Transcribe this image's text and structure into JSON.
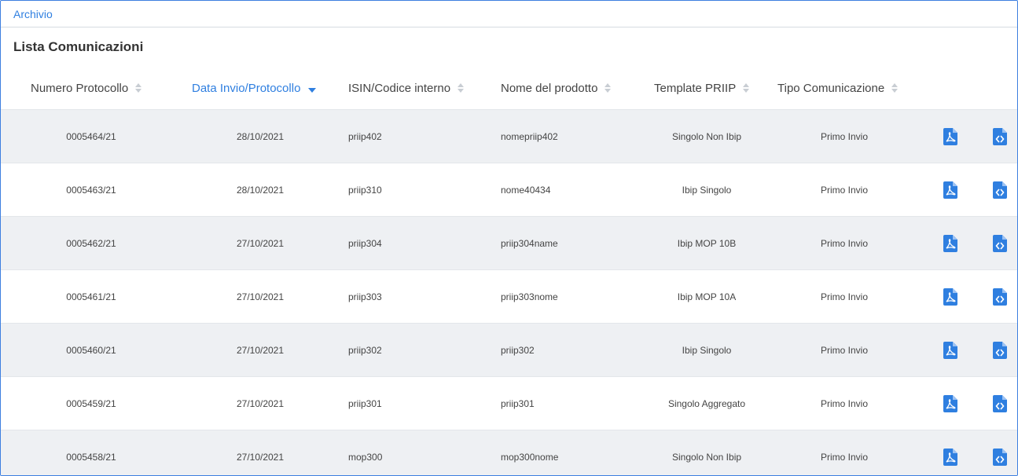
{
  "breadcrumb": {
    "label": "Archivio"
  },
  "page": {
    "title": "Lista Comunicazioni"
  },
  "colors": {
    "accent": "#2f7fe0",
    "row_alt": "#eef0f3"
  },
  "table": {
    "columns": [
      {
        "label": "Numero Protocollo",
        "sort": "none"
      },
      {
        "label": "Data Invio/Protocollo",
        "sort": "desc"
      },
      {
        "label": "ISIN/Codice interno",
        "sort": "none"
      },
      {
        "label": "Nome del prodotto",
        "sort": "none"
      },
      {
        "label": "Template PRIIP",
        "sort": "none"
      },
      {
        "label": "Tipo Comunicazione",
        "sort": "none"
      }
    ],
    "row_icons": [
      "pdf-file-icon",
      "code-file-icon"
    ],
    "rows": [
      {
        "protocol": "0005464/21",
        "date": "28/10/2021",
        "isin": "priip402",
        "name": "nomepriip402",
        "template": "Singolo Non Ibip",
        "type": "Primo Invio"
      },
      {
        "protocol": "0005463/21",
        "date": "28/10/2021",
        "isin": "priip310",
        "name": "nome40434",
        "template": "Ibip Singolo",
        "type": "Primo Invio"
      },
      {
        "protocol": "0005462/21",
        "date": "27/10/2021",
        "isin": "priip304",
        "name": "priip304name",
        "template": "Ibip MOP 10B",
        "type": "Primo Invio"
      },
      {
        "protocol": "0005461/21",
        "date": "27/10/2021",
        "isin": "priip303",
        "name": "priip303nome",
        "template": "Ibip MOP 10A",
        "type": "Primo Invio"
      },
      {
        "protocol": "0005460/21",
        "date": "27/10/2021",
        "isin": "priip302",
        "name": "priip302",
        "template": "Ibip Singolo",
        "type": "Primo Invio"
      },
      {
        "protocol": "0005459/21",
        "date": "27/10/2021",
        "isin": "priip301",
        "name": "priip301",
        "template": "Singolo Aggregato",
        "type": "Primo Invio"
      },
      {
        "protocol": "0005458/21",
        "date": "27/10/2021",
        "isin": "mop300",
        "name": "mop300nome",
        "template": "Singolo Non Ibip",
        "type": "Primo Invio"
      }
    ]
  }
}
